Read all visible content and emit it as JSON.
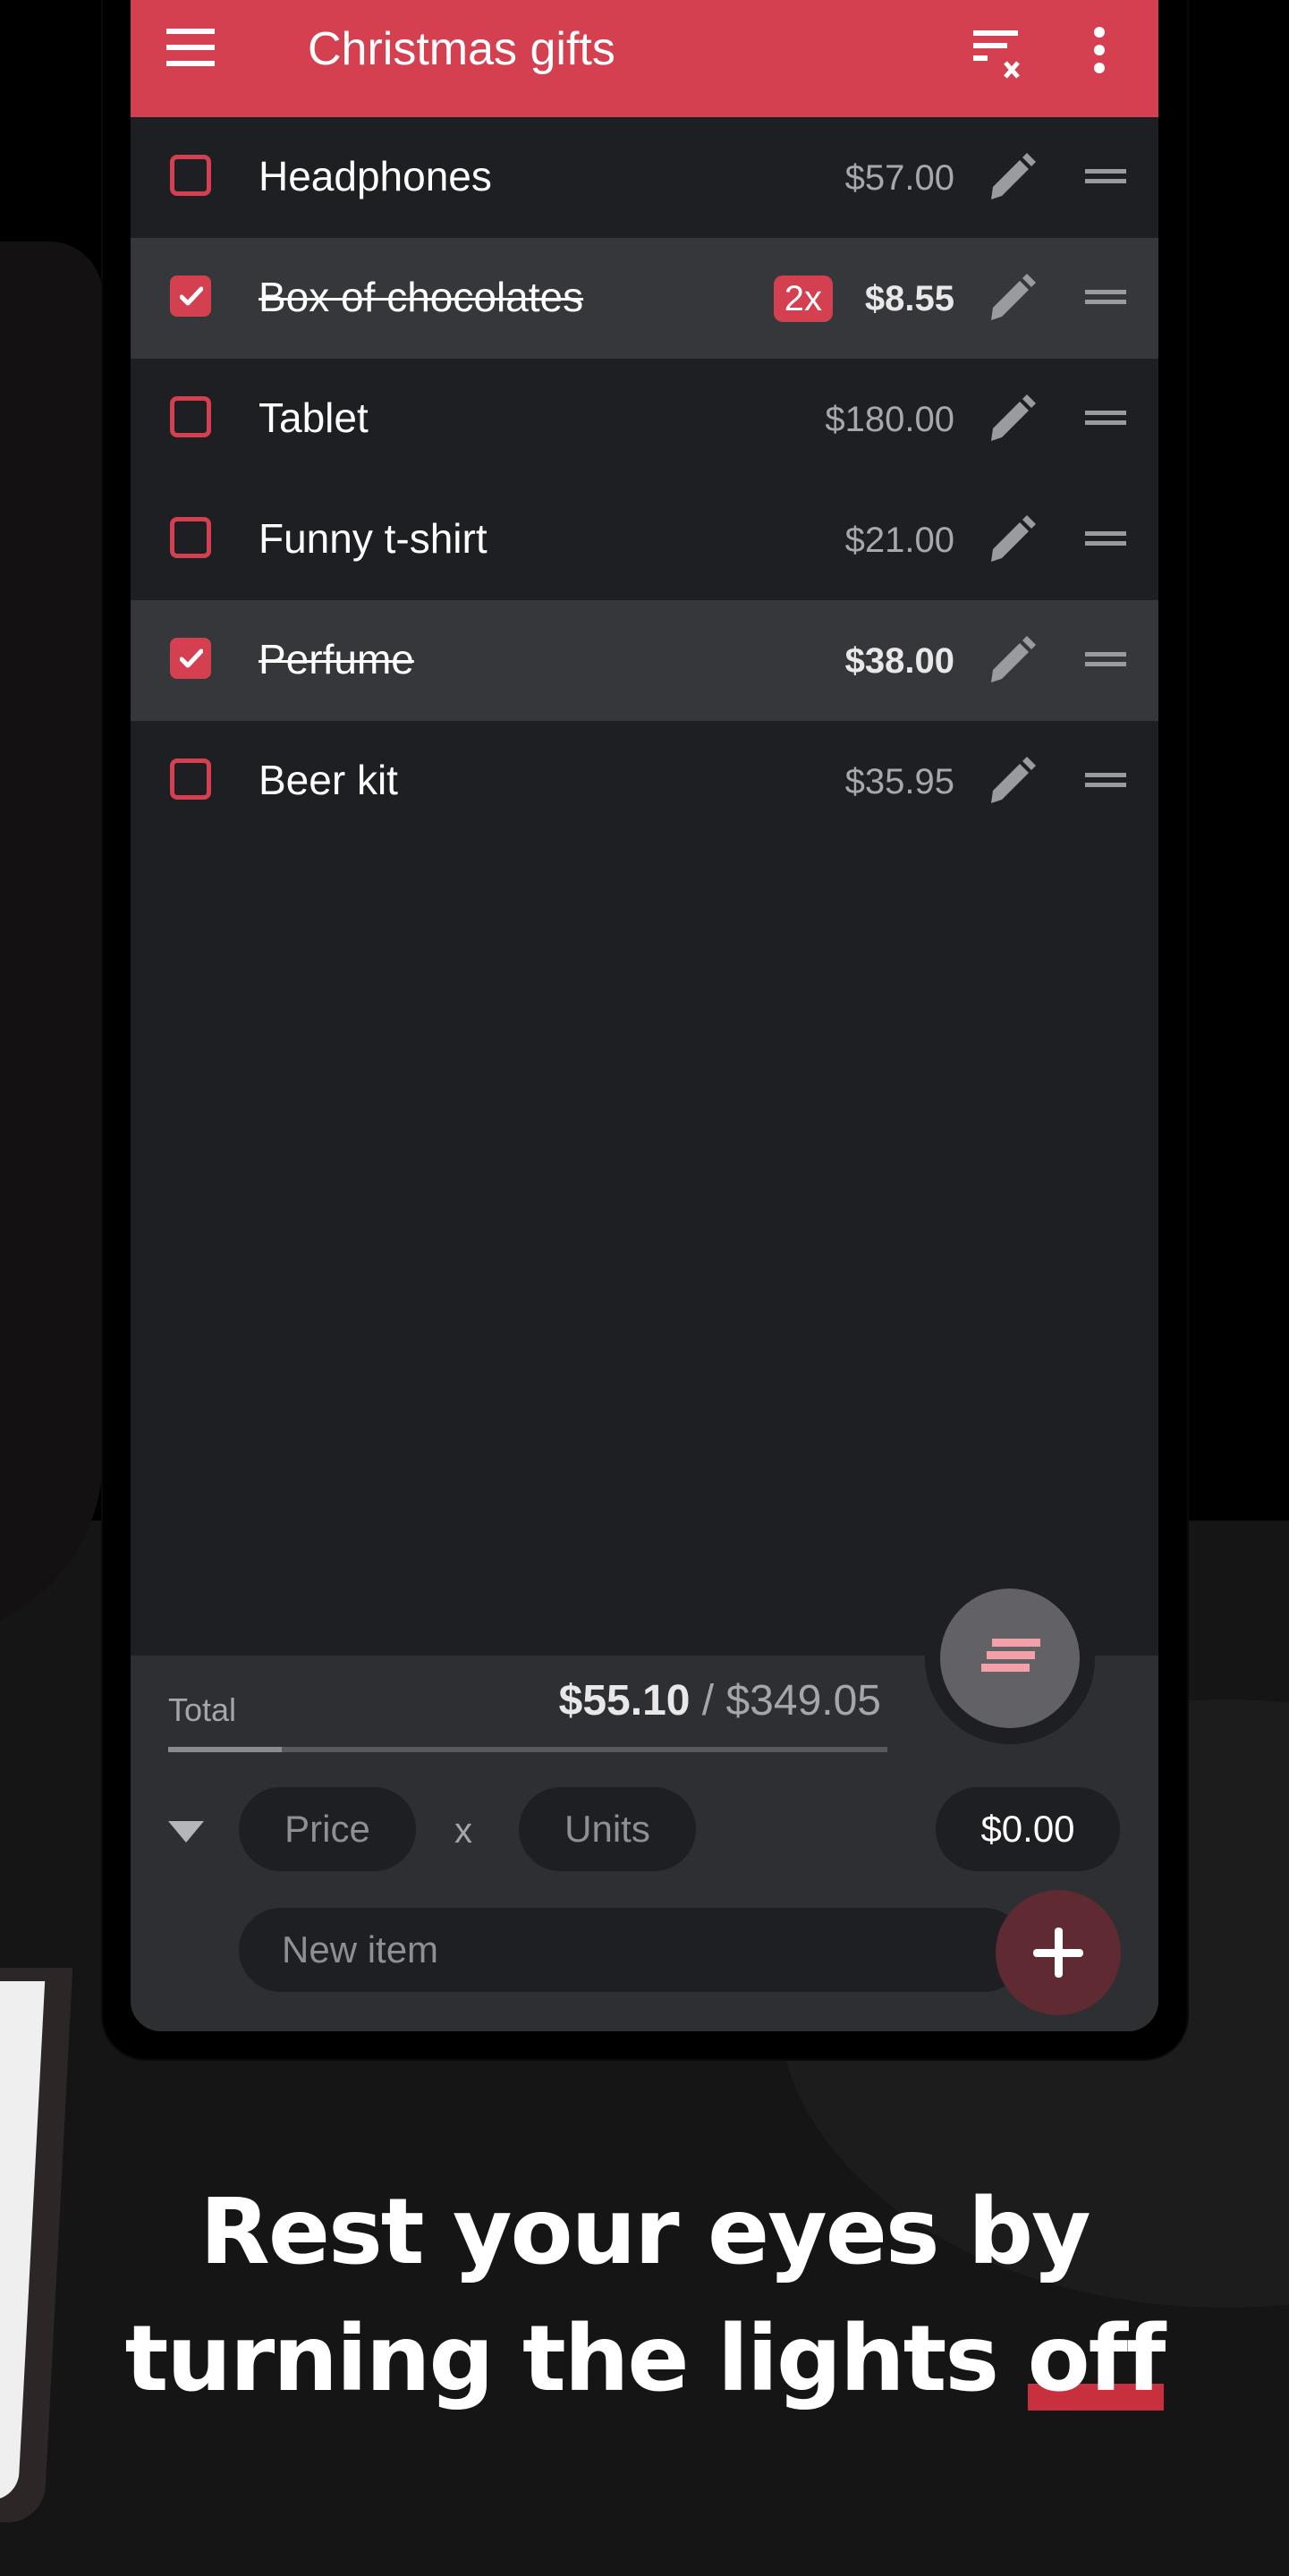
{
  "app": {
    "title": "Christmas gifts",
    "accent_color": "#d4404f",
    "icons": {
      "menu": "hamburger-menu-icon",
      "clear_checked": "clear-list-icon",
      "more": "more-vert-icon",
      "edit": "pencil-icon",
      "drag": "drag-handle-icon",
      "sort": "sort-icon",
      "expand": "triangle-down-icon",
      "add": "plus-icon"
    }
  },
  "items": [
    {
      "name": "Headphones",
      "price": "$57.00",
      "checked": false,
      "quantity": ""
    },
    {
      "name": "Box of chocolates",
      "price": "$8.55",
      "checked": true,
      "quantity": "2x"
    },
    {
      "name": "Tablet",
      "price": "$180.00",
      "checked": false,
      "quantity": ""
    },
    {
      "name": "Funny t-shirt",
      "price": "$21.00",
      "checked": false,
      "quantity": ""
    },
    {
      "name": "Perfume",
      "price": "$38.00",
      "checked": true,
      "quantity": ""
    },
    {
      "name": "Beer kit",
      "price": "$35.95",
      "checked": false,
      "quantity": ""
    }
  ],
  "footer": {
    "total_label": "Total",
    "checked_total": "$55.10",
    "separator": " / ",
    "grand_total": "$349.05",
    "progress_fraction": 0.158,
    "price_placeholder": "Price",
    "times_label": "x",
    "units_placeholder": "Units",
    "subtotal": "$0.00",
    "new_item_placeholder": "New item"
  },
  "caption": {
    "line1": "Rest your eyes by",
    "line2_prefix": "turning the lights ",
    "line2_highlight": "off"
  }
}
